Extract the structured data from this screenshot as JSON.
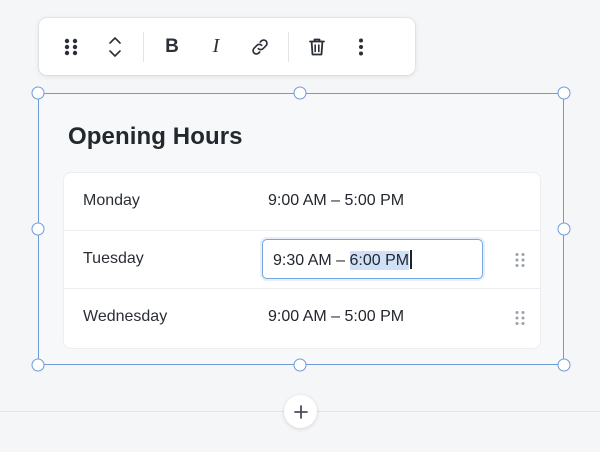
{
  "toolbar": {
    "drag_icon": "drag-handle-icon",
    "move_icon": "move-up-down-icon",
    "bold_label": "B",
    "italic_label": "I",
    "link_icon": "link-icon",
    "delete_icon": "trash-icon",
    "more_icon": "more-vertical-icon"
  },
  "block": {
    "title": "Opening Hours",
    "rows": [
      {
        "day": "Monday",
        "hours": "9:00 AM – 5:00 PM",
        "editing": false
      },
      {
        "day": "Tuesday",
        "hours": "9:30 AM – 6:00 PM",
        "editing": true,
        "hours_before_selection": "9:30 AM – ",
        "hours_selected": "6:00 PM"
      },
      {
        "day": "Wednesday",
        "hours": "9:00 AM – 5:00 PM",
        "editing": false
      }
    ]
  },
  "add_block": {
    "label": "+",
    "icon": "plus-icon"
  },
  "colors": {
    "selection_outline": "#6e9bd8",
    "text_selection": "#cfe0f7",
    "background": "#f5f6f8"
  }
}
